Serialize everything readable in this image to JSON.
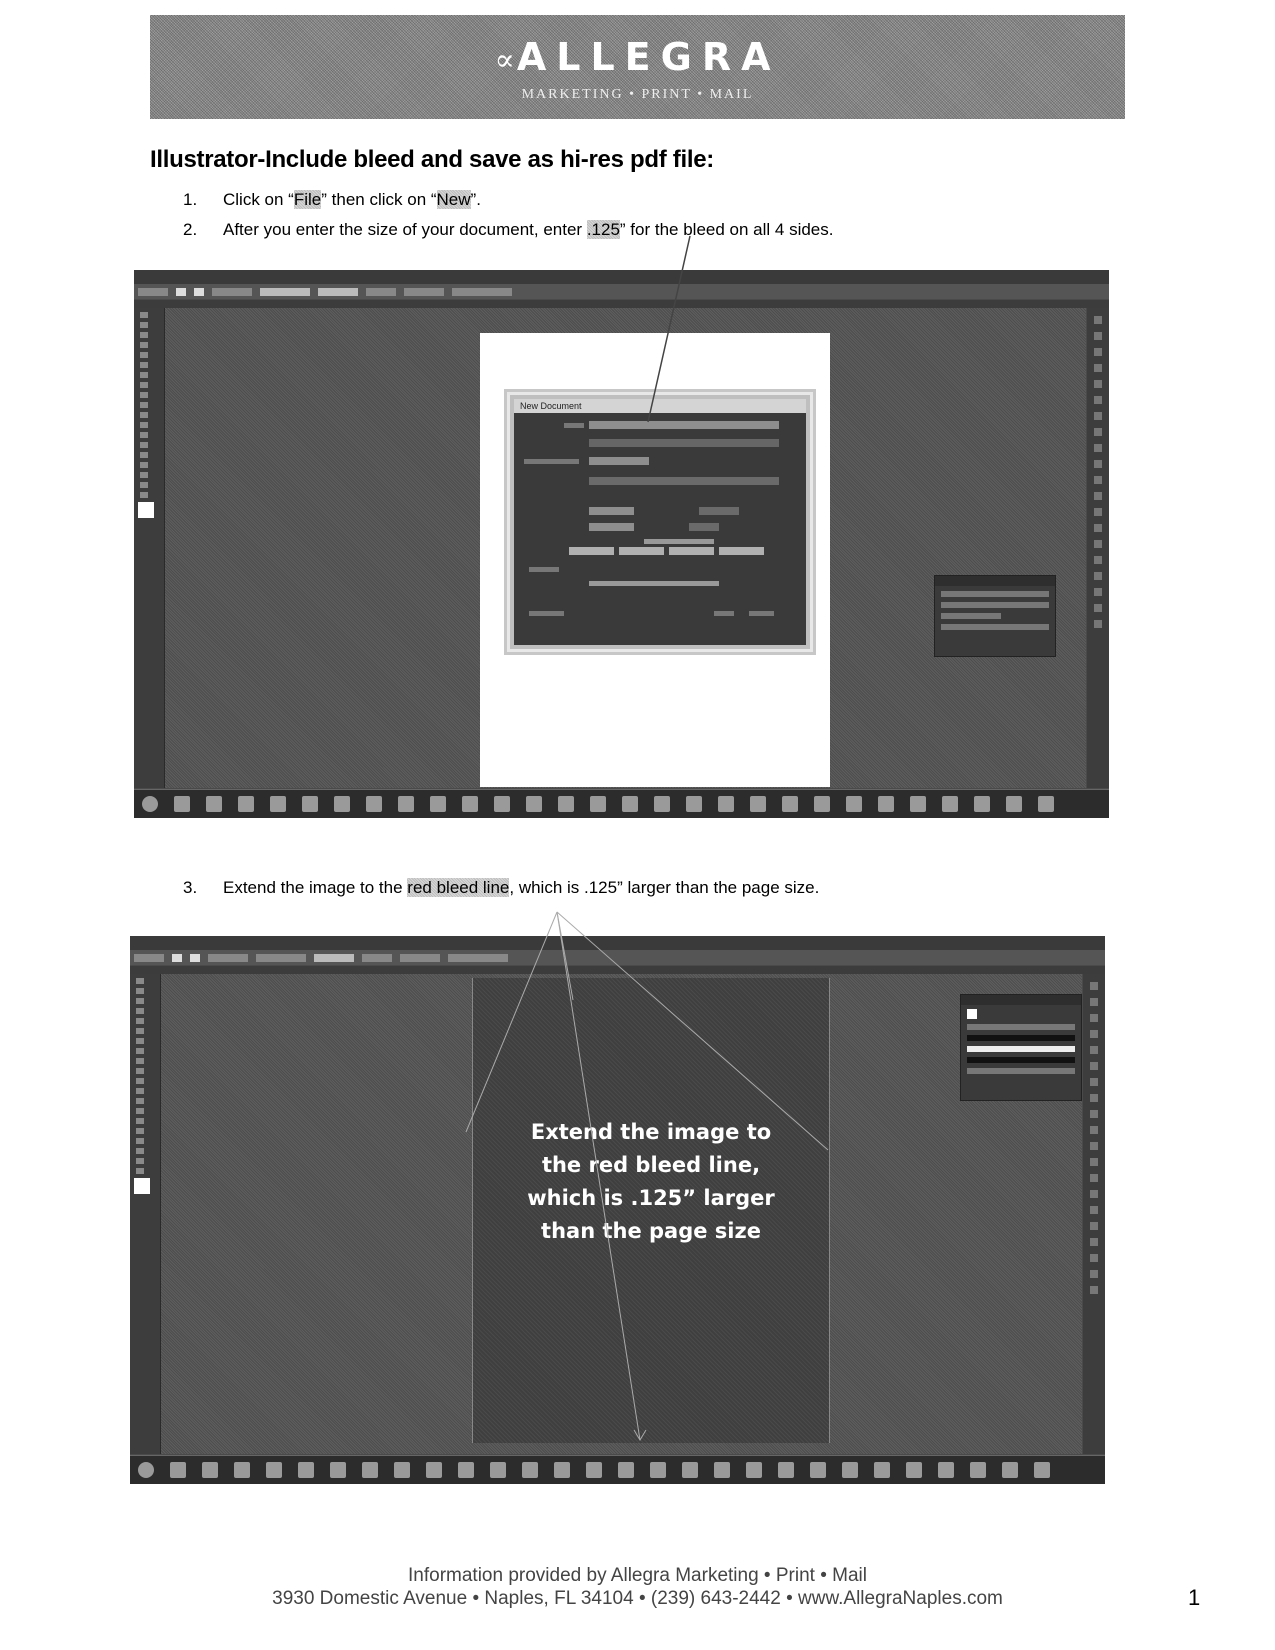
{
  "banner": {
    "logo_mark": "∝",
    "logo_text": "ALLEGRA",
    "tagline": "MARKETING • PRINT • MAIL",
    "background_color": "#8a8a8a"
  },
  "heading": "Illustrator-Include bleed and save as hi-res pdf file:",
  "steps": [
    {
      "number": "1.",
      "parts": [
        "Click on “",
        "File",
        "” then click on “",
        "New",
        "”."
      ]
    },
    {
      "number": "2.",
      "parts": [
        "After you enter the size of your document, enter ",
        ".125",
        "” for the bleed on all 4 sides."
      ]
    },
    {
      "number": "3.",
      "parts": [
        "Extend the image to the ",
        "red bleed line",
        ", which is .125” larger than the page size."
      ]
    }
  ],
  "screenshot1": {
    "app": "Adobe Illustrator",
    "dialog_title": "New Document",
    "description": "Illustrator workspace with New Document dialog showing bleed fields"
  },
  "screenshot2": {
    "app": "Adobe Illustrator",
    "overlay_lines": [
      "Extend the image to",
      "the red bleed line,",
      "which is .125” larger",
      "than the page size"
    ]
  },
  "footer": {
    "line1": "Information provided by Allegra Marketing • Print • Mail",
    "line2": "3930 Domestic Avenue • Naples, FL 34104 • (239) 643-2442 • www.AllegraNaples.com",
    "page_number": "1"
  }
}
